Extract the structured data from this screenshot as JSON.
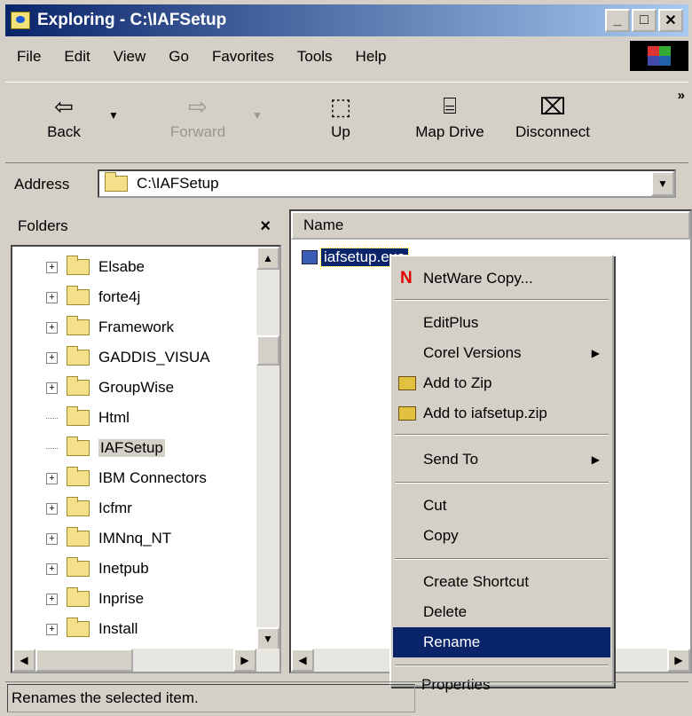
{
  "window": {
    "title": "Exploring - C:\\IAFSetup",
    "min": "_",
    "max": "□",
    "close": "✕"
  },
  "menubar": [
    "File",
    "Edit",
    "View",
    "Go",
    "Favorites",
    "Tools",
    "Help"
  ],
  "toolbar": {
    "back": "Back",
    "forward": "Forward",
    "up": "Up",
    "map_drive": "Map Drive",
    "disconnect": "Disconnect",
    "more": "»"
  },
  "address": {
    "label": "Address",
    "value": "C:\\IAFSetup"
  },
  "folders": {
    "title": "Folders",
    "close": "×",
    "items": [
      "Elsabe",
      "forte4j",
      "Framework",
      "GADDIS_VISUA",
      "GroupWise",
      "Html",
      "IAFSetup",
      "IBM Connectors",
      "Icfmr",
      "IMNnq_NT",
      "Inetpub",
      "Inprise",
      "Install"
    ]
  },
  "filelist": {
    "column": "Name",
    "file": "iafsetup.exe"
  },
  "context_menu": {
    "netware": "NetWare Copy...",
    "editplus": "EditPlus",
    "corel": "Corel Versions",
    "add_zip": "Add to Zip",
    "add_iaf": "Add to iafsetup.zip",
    "send_to": "Send To",
    "cut": "Cut",
    "copy": "Copy",
    "shortcut": "Create Shortcut",
    "delete": "Delete",
    "rename": "Rename",
    "properties": "Properties"
  },
  "status": "Renames the selected item."
}
